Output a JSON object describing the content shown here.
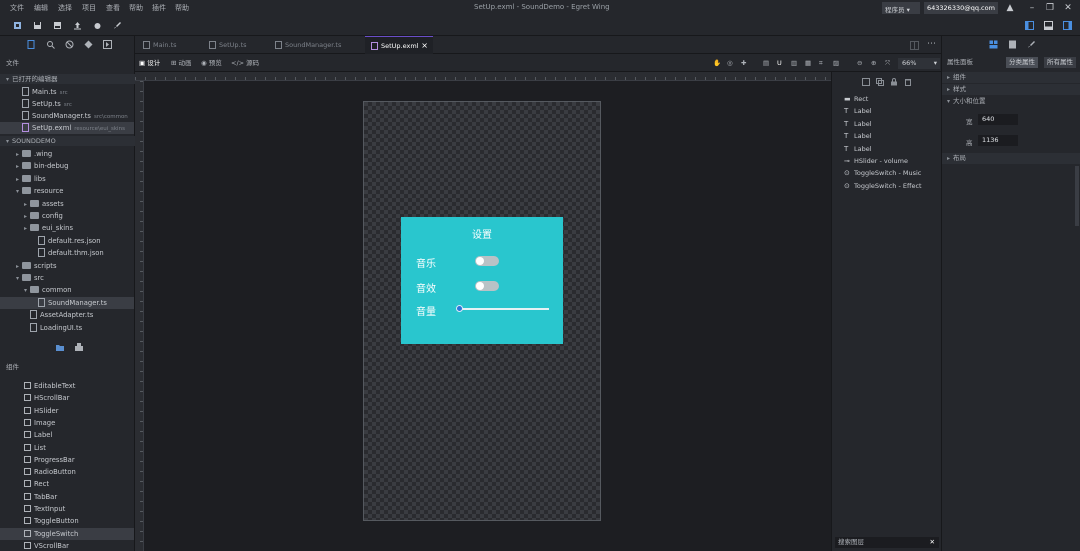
{
  "menu": [
    "文件",
    "编辑",
    "选择",
    "项目",
    "查看",
    "帮助",
    "插件",
    "帮助"
  ],
  "window_title": "SetUp.exml - SoundDemo - Egret Wing",
  "user": {
    "role": "程序员",
    "email": "643326330@qq.com"
  },
  "left_panel": {
    "header": "文件",
    "open_editors_header": "已打开的编辑器",
    "open_editors": [
      {
        "name": "Main.ts",
        "path": "src"
      },
      {
        "name": "SetUp.ts",
        "path": "src"
      },
      {
        "name": "SoundManager.ts",
        "path": "src\\common"
      },
      {
        "name": "SetUp.exml",
        "path": "resource\\eui_skins"
      }
    ],
    "project_header": "SOUNDDEMO",
    "tree": [
      {
        "name": ".wing",
        "depth": 1,
        "type": "folder"
      },
      {
        "name": "bin-debug",
        "depth": 1,
        "type": "folder"
      },
      {
        "name": "libs",
        "depth": 1,
        "type": "folder"
      },
      {
        "name": "resource",
        "depth": 1,
        "type": "folder"
      },
      {
        "name": "assets",
        "depth": 2,
        "type": "folder"
      },
      {
        "name": "config",
        "depth": 2,
        "type": "folder"
      },
      {
        "name": "eui_skins",
        "depth": 2,
        "type": "folder"
      },
      {
        "name": "default.res.json",
        "depth": 3,
        "type": "file"
      },
      {
        "name": "default.thm.json",
        "depth": 3,
        "type": "file"
      },
      {
        "name": "scripts",
        "depth": 1,
        "type": "folder"
      },
      {
        "name": "src",
        "depth": 1,
        "type": "folder"
      },
      {
        "name": "common",
        "depth": 2,
        "type": "folder"
      },
      {
        "name": "SoundManager.ts",
        "depth": 3,
        "type": "file"
      },
      {
        "name": "AssetAdapter.ts",
        "depth": 2,
        "type": "file"
      },
      {
        "name": "LoadingUI.ts",
        "depth": 2,
        "type": "file"
      }
    ],
    "components_header": "组件",
    "components": [
      "EditableText",
      "HScrollBar",
      "HSlider",
      "Image",
      "Label",
      "List",
      "ProgressBar",
      "RadioButton",
      "Rect",
      "TabBar",
      "TextInput",
      "ToggleButton",
      "ToggleSwitch",
      "VScrollBar"
    ]
  },
  "tabs": [
    {
      "label": "Main.ts",
      "active": false
    },
    {
      "label": "SetUp.ts",
      "active": false
    },
    {
      "label": "SoundManager.ts",
      "active": false
    },
    {
      "label": "SetUp.exml",
      "active": true
    }
  ],
  "editor_modes": [
    "设计",
    "动画",
    "预览",
    "源码"
  ],
  "zoom": "66%",
  "dialog": {
    "title": "设置",
    "music_label": "音乐",
    "effect_label": "音效",
    "volume_label": "音量"
  },
  "outline": {
    "items": [
      {
        "icon": "rect-icon",
        "label": "Rect"
      },
      {
        "icon": "label-icon",
        "label": "Label"
      },
      {
        "icon": "label-icon",
        "label": "Label"
      },
      {
        "icon": "label-icon",
        "label": "Label"
      },
      {
        "icon": "label-icon",
        "label": "Label"
      },
      {
        "icon": "slider-icon",
        "label": "HSlider - volume"
      },
      {
        "icon": "toggle-icon",
        "label": "ToggleSwitch - Music"
      },
      {
        "icon": "toggle-icon",
        "label": "ToggleSwitch - Effect"
      }
    ],
    "search_placeholder": "搜索图层"
  },
  "right_panel": {
    "header": "属性面板",
    "btn_category": "分类属性",
    "btn_all": "所有属性",
    "sections": [
      "组件",
      "样式",
      "大小和位置"
    ],
    "width_label": "宽",
    "width_value": "640",
    "height_label": "高",
    "height_value": "1136",
    "layout_section": "布局"
  },
  "colors": {
    "dialog_bg": "#29c6ce",
    "accent": "#6a4ec9"
  }
}
